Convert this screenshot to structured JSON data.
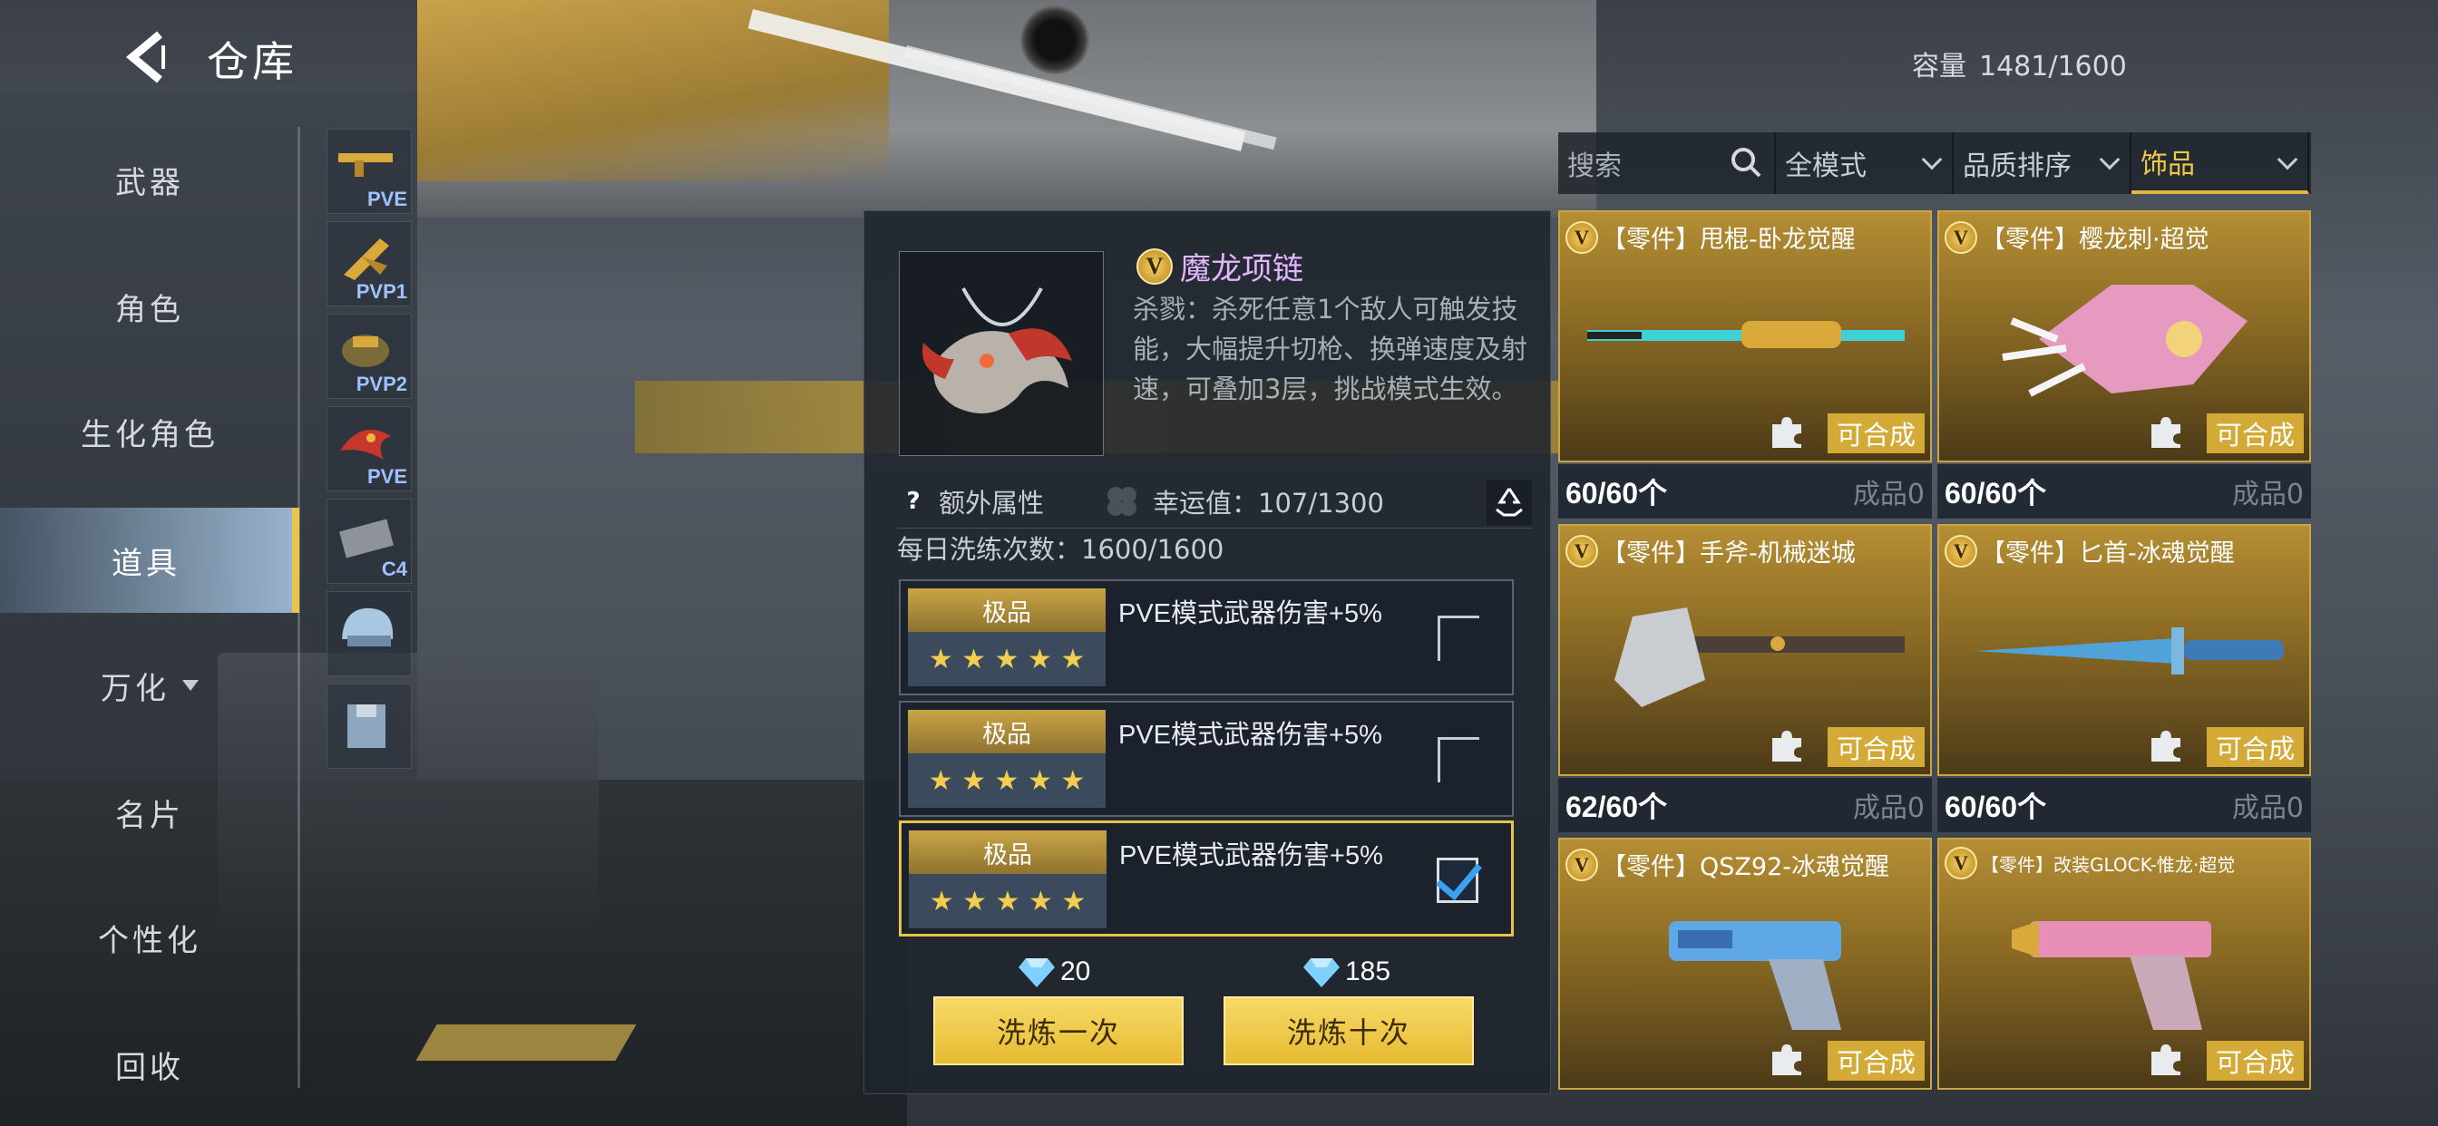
{
  "header": {
    "title": "仓库",
    "capacity_label": "容量",
    "capacity_value": "1481/1600"
  },
  "nav": {
    "items": [
      {
        "label": "武器"
      },
      {
        "label": "角色"
      },
      {
        "label": "生化角色"
      },
      {
        "label": "道具",
        "active": true
      },
      {
        "label": "万化",
        "has_dropdown": true
      },
      {
        "label": "名片"
      },
      {
        "label": "个性化"
      },
      {
        "label": "回收"
      }
    ]
  },
  "thumbs": [
    {
      "label": "PVE",
      "icon": "golden-gun-icon"
    },
    {
      "label": "PVP1",
      "icon": "golden-claw-icon"
    },
    {
      "label": "PVP2",
      "icon": "golden-bag-icon"
    },
    {
      "label": "PVE",
      "icon": "red-dragon-icon"
    },
    {
      "label": "C4",
      "icon": "c4-bomb-icon"
    },
    {
      "label": "",
      "icon": "helmet-icon"
    },
    {
      "label": "",
      "icon": "vest-icon"
    }
  ],
  "detail": {
    "badge": "V",
    "name": "魔龙项链",
    "description": "杀戮：杀死任意1个敌人可触发技能，大幅提升切枪、换弹速度及射速，可叠加3层，挑战模式生效。",
    "extra_attr_label": "额外属性",
    "luck_label": "幸运值：107/1300",
    "daily_label": "每日洗练次数：1600/1600",
    "attributes": [
      {
        "grade": "极品",
        "stars": "★ ★ ★ ★ ★",
        "text": "PVE模式武器伤害+5%",
        "checked": false
      },
      {
        "grade": "极品",
        "stars": "★ ★ ★ ★ ★",
        "text": "PVE模式武器伤害+5%",
        "checked": false
      },
      {
        "grade": "极品",
        "stars": "★ ★ ★ ★ ★",
        "text": "PVE模式武器伤害+5%",
        "checked": true
      }
    ],
    "cost_once": "20",
    "cost_ten": "185",
    "btn_once": "洗炼一次",
    "btn_ten": "洗炼十次"
  },
  "filters": {
    "search_placeholder": "搜索",
    "mode": "全模式",
    "sort": "品质排序",
    "category": "饰品"
  },
  "cards": [
    {
      "title": "【零件】甩棍-卧龙觉醒",
      "craft": "可合成",
      "count": "60/60个",
      "finished": "成品0"
    },
    {
      "title": "【零件】樱龙刺·超觉",
      "craft": "可合成",
      "count": "60/60个",
      "finished": "成品0"
    },
    {
      "title": "【零件】手斧-机械迷城",
      "craft": "可合成",
      "count": "62/60个",
      "finished": "成品0"
    },
    {
      "title": "【零件】匕首-冰魂觉醒",
      "craft": "可合成",
      "count": "60/60个",
      "finished": "成品0"
    },
    {
      "title": "【零件】QSZ92-冰魂觉醒",
      "craft": "可合成"
    },
    {
      "title": "【零件】改装GLOCK-惟龙·超觉",
      "craft": "可合成"
    }
  ],
  "colors": {
    "accent_gold": "#e8c24a",
    "name_purple": "#e4b6ff",
    "check_blue": "#3aa0f0"
  }
}
